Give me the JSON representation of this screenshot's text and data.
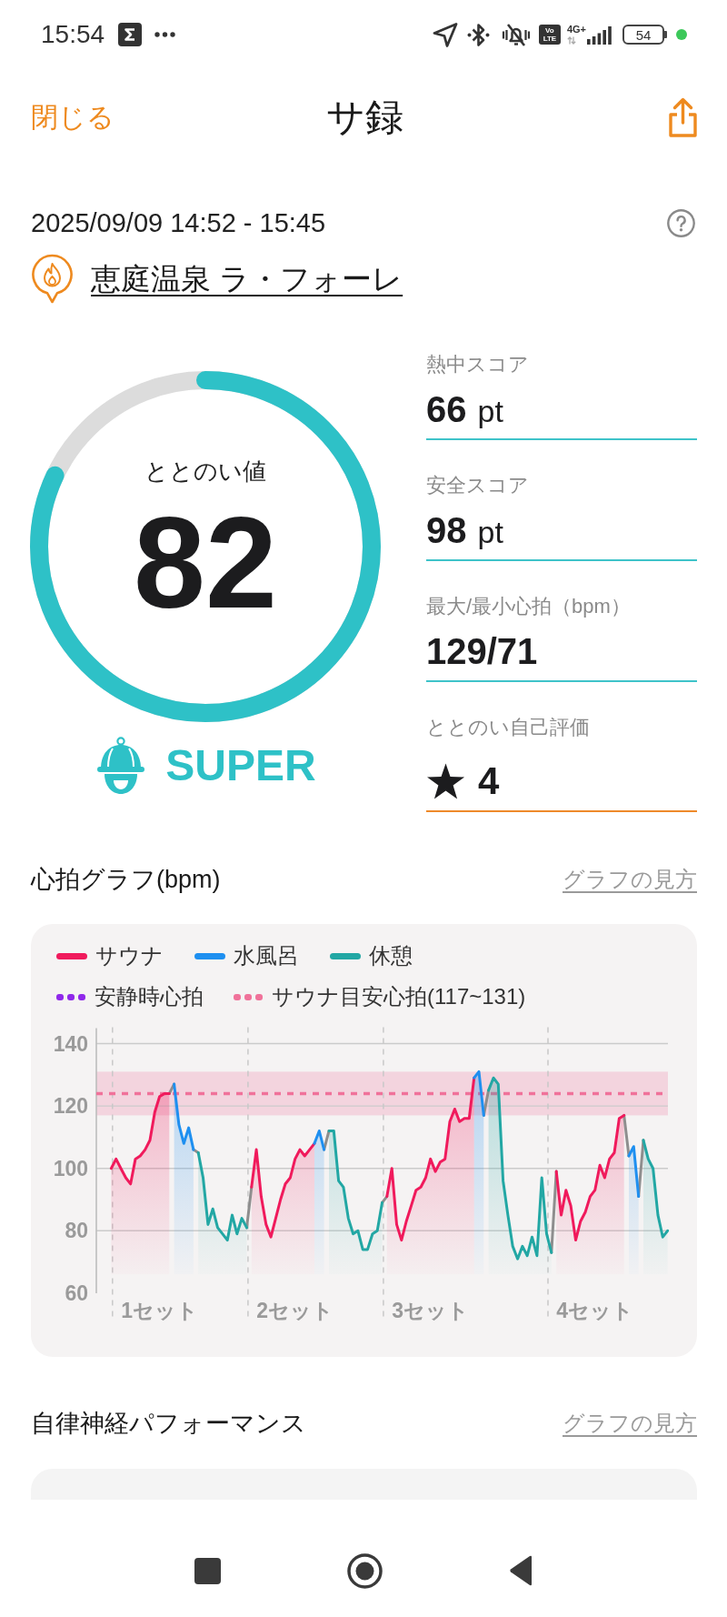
{
  "status_bar": {
    "time": "15:54",
    "network_badge": "Vo LTE",
    "network_type": "4G+",
    "battery": "54"
  },
  "header": {
    "close": "閉じる",
    "title": "サ録"
  },
  "session": {
    "datetime": "2025/09/09 14:52 - 15:45",
    "facility": "恵庭温泉 ラ・フォーレ"
  },
  "score": {
    "label": "ととのい値",
    "value": "82",
    "level": 0.82,
    "rank": "SUPER"
  },
  "stats": [
    {
      "kind": "score",
      "label": "熱中スコア",
      "value": "66",
      "unit": "pt"
    },
    {
      "kind": "score",
      "label": "安全スコア",
      "value": "98",
      "unit": "pt"
    },
    {
      "kind": "score",
      "label": "最大/最小心拍（bpm）",
      "value": "129/71"
    },
    {
      "kind": "rating",
      "label": "ととのい自己評価",
      "value": "4"
    }
  ],
  "heart_rate": {
    "title": "心拍グラフ(bpm)",
    "help_link": "グラフの見方",
    "reference_legend": [
      {
        "label": "安静時心拍",
        "color": "#8f28ea"
      },
      {
        "label": "サウナ目安心拍(117~131)",
        "color": "#f0729a"
      }
    ],
    "chart_data": {
      "type": "area",
      "grid": true,
      "categories": [
        null,
        null,
        null,
        null,
        null,
        null,
        null,
        null,
        null,
        null,
        "1セット",
        null,
        null,
        null,
        null,
        null,
        null,
        null,
        null,
        null,
        null,
        null,
        null,
        null,
        null,
        null,
        null,
        null,
        null,
        null,
        null,
        null,
        null,
        null,
        null,
        null,
        null,
        null,
        "2セット",
        null,
        null,
        null,
        null,
        null,
        null,
        null,
        null,
        null,
        null,
        null,
        null,
        null,
        null,
        null,
        null,
        null,
        null,
        null,
        null,
        null,
        null,
        null,
        null,
        null,
        null,
        null,
        "3セット",
        null,
        null,
        null,
        null,
        null,
        null,
        null,
        null,
        null,
        null,
        null,
        null,
        null,
        null,
        null,
        null,
        null,
        null,
        null,
        null,
        null,
        null,
        null,
        null,
        null,
        null,
        null,
        null,
        null,
        null,
        null,
        null,
        null,
        "4セット",
        null,
        null,
        null,
        null,
        null,
        null,
        null,
        null,
        null,
        null,
        null,
        null,
        null,
        null,
        null
      ],
      "ylim": [
        60,
        140
      ],
      "yticks": [
        60,
        80,
        100,
        120,
        140
      ],
      "series": [
        {
          "name": "サウナ",
          "color": "#f01a5c",
          "values": [
            100,
            103,
            100,
            97,
            95,
            103,
            104,
            106,
            109,
            118,
            123,
            124,
            124,
            null,
            null,
            null,
            null,
            null,
            null,
            null,
            null,
            null,
            null,
            null,
            null,
            null,
            null,
            null,
            null,
            94,
            106,
            91,
            82,
            78,
            84,
            90,
            95,
            97,
            103,
            106,
            104,
            106,
            108,
            null,
            null,
            null,
            null,
            null,
            null,
            null,
            null,
            null,
            null,
            null,
            null,
            null,
            null,
            91,
            100,
            82,
            77,
            83,
            88,
            93,
            94,
            97,
            103,
            99,
            102,
            103,
            115,
            119,
            115,
            116,
            116,
            129,
            null,
            null,
            null,
            null,
            null,
            null,
            null,
            null,
            null,
            null,
            null,
            null,
            null,
            null,
            null,
            null,
            99,
            85,
            93,
            88,
            77,
            83,
            86,
            91,
            93,
            101,
            97,
            103,
            105,
            116,
            117,
            null,
            null,
            null,
            null,
            null,
            null,
            null,
            null,
            null
          ]
        },
        {
          "name": "水風呂",
          "color": "#1e8ff0",
          "values": [
            null,
            null,
            null,
            null,
            null,
            null,
            null,
            null,
            null,
            null,
            null,
            null,
            null,
            127,
            114,
            108,
            113,
            106,
            null,
            null,
            null,
            null,
            null,
            null,
            null,
            null,
            null,
            null,
            null,
            null,
            null,
            null,
            null,
            null,
            null,
            null,
            null,
            null,
            null,
            null,
            null,
            null,
            108,
            112,
            106,
            null,
            null,
            null,
            null,
            null,
            null,
            null,
            null,
            null,
            null,
            null,
            null,
            null,
            null,
            null,
            null,
            null,
            null,
            null,
            null,
            null,
            null,
            null,
            null,
            null,
            null,
            null,
            null,
            null,
            null,
            129,
            131,
            117,
            null,
            null,
            null,
            null,
            null,
            null,
            null,
            null,
            null,
            null,
            null,
            null,
            null,
            null,
            null,
            null,
            null,
            null,
            null,
            null,
            null,
            null,
            null,
            null,
            null,
            null,
            null,
            null,
            null,
            104,
            107,
            91,
            null,
            null,
            null,
            null,
            null,
            null
          ]
        },
        {
          "name": "休憩",
          "color": "#22a7a4",
          "values": [
            null,
            null,
            null,
            null,
            null,
            null,
            null,
            null,
            null,
            null,
            null,
            null,
            null,
            null,
            null,
            null,
            null,
            null,
            105,
            97,
            82,
            87,
            81,
            79,
            77,
            85,
            79,
            84,
            81,
            null,
            null,
            null,
            null,
            null,
            null,
            null,
            null,
            null,
            null,
            null,
            null,
            null,
            null,
            null,
            null,
            112,
            112,
            96,
            94,
            84,
            79,
            80,
            74,
            74,
            79,
            80,
            89,
            null,
            null,
            null,
            null,
            null,
            null,
            null,
            null,
            null,
            null,
            null,
            null,
            null,
            null,
            null,
            null,
            null,
            null,
            null,
            null,
            null,
            125,
            129,
            127,
            96,
            85,
            75,
            71,
            75,
            72,
            78,
            72,
            97,
            79,
            73,
            null,
            null,
            null,
            null,
            null,
            null,
            null,
            null,
            null,
            null,
            null,
            null,
            null,
            null,
            null,
            null,
            null,
            null,
            109,
            103,
            100,
            85,
            78,
            80
          ]
        },
        {
          "type": "line",
          "color": "#8e8e8e",
          "values": [
            null,
            null,
            null,
            null,
            null,
            null,
            null,
            null,
            null,
            null,
            null,
            null,
            124,
            127,
            null,
            null,
            null,
            null,
            null,
            null,
            null,
            null,
            null,
            null,
            null,
            null,
            null,
            null,
            81,
            94,
            null,
            null,
            null,
            null,
            null,
            null,
            null,
            null,
            null,
            null,
            null,
            null,
            null,
            null,
            null,
            null,
            null,
            null,
            null,
            null,
            null,
            null,
            null,
            null,
            null,
            null,
            89,
            91,
            null,
            null,
            null,
            null,
            null,
            null,
            null,
            null,
            null,
            null,
            null,
            null,
            null,
            null,
            null,
            null,
            null,
            null,
            null,
            null,
            null,
            null,
            null,
            null,
            null,
            null,
            null,
            null,
            null,
            null,
            null,
            null,
            null,
            73,
            99,
            null,
            null,
            null,
            null,
            null,
            null,
            null,
            null,
            null,
            null,
            null,
            null,
            null,
            117,
            104,
            null,
            null,
            null,
            null,
            null,
            null,
            null,
            null
          ]
        },
        {
          "type": "line",
          "color": "#8e8e8e",
          "values": [
            null,
            null,
            null,
            null,
            null,
            null,
            null,
            null,
            null,
            null,
            null,
            null,
            null,
            null,
            null,
            null,
            null,
            106,
            105,
            null,
            null,
            null,
            null,
            null,
            null,
            null,
            null,
            null,
            null,
            null,
            null,
            null,
            null,
            null,
            null,
            null,
            null,
            null,
            null,
            null,
            null,
            null,
            null,
            null,
            106,
            112,
            null,
            null,
            null,
            null,
            null,
            null,
            null,
            null,
            null,
            null,
            null,
            null,
            null,
            null,
            null,
            null,
            null,
            null,
            null,
            null,
            null,
            null,
            null,
            null,
            null,
            null,
            null,
            null,
            null,
            null,
            null,
            117,
            125,
            null,
            null,
            null,
            null,
            null,
            null,
            null,
            null,
            null,
            null,
            null,
            null,
            null,
            null,
            null,
            null,
            null,
            null,
            null,
            null,
            null,
            null,
            null,
            null,
            null,
            null,
            null,
            null,
            null,
            null,
            91,
            109,
            null,
            null,
            null,
            null,
            null
          ]
        }
      ],
      "bands": [
        {
          "axis": "y",
          "from": 117,
          "to": 131,
          "color": "#f0729a"
        }
      ],
      "ref_lines": [
        {
          "axis": "y",
          "value": 124,
          "color": "#f0729a"
        }
      ]
    }
  },
  "autonomic": {
    "title": "自律神経パフォーマンス",
    "help_link": "グラフの見方"
  }
}
